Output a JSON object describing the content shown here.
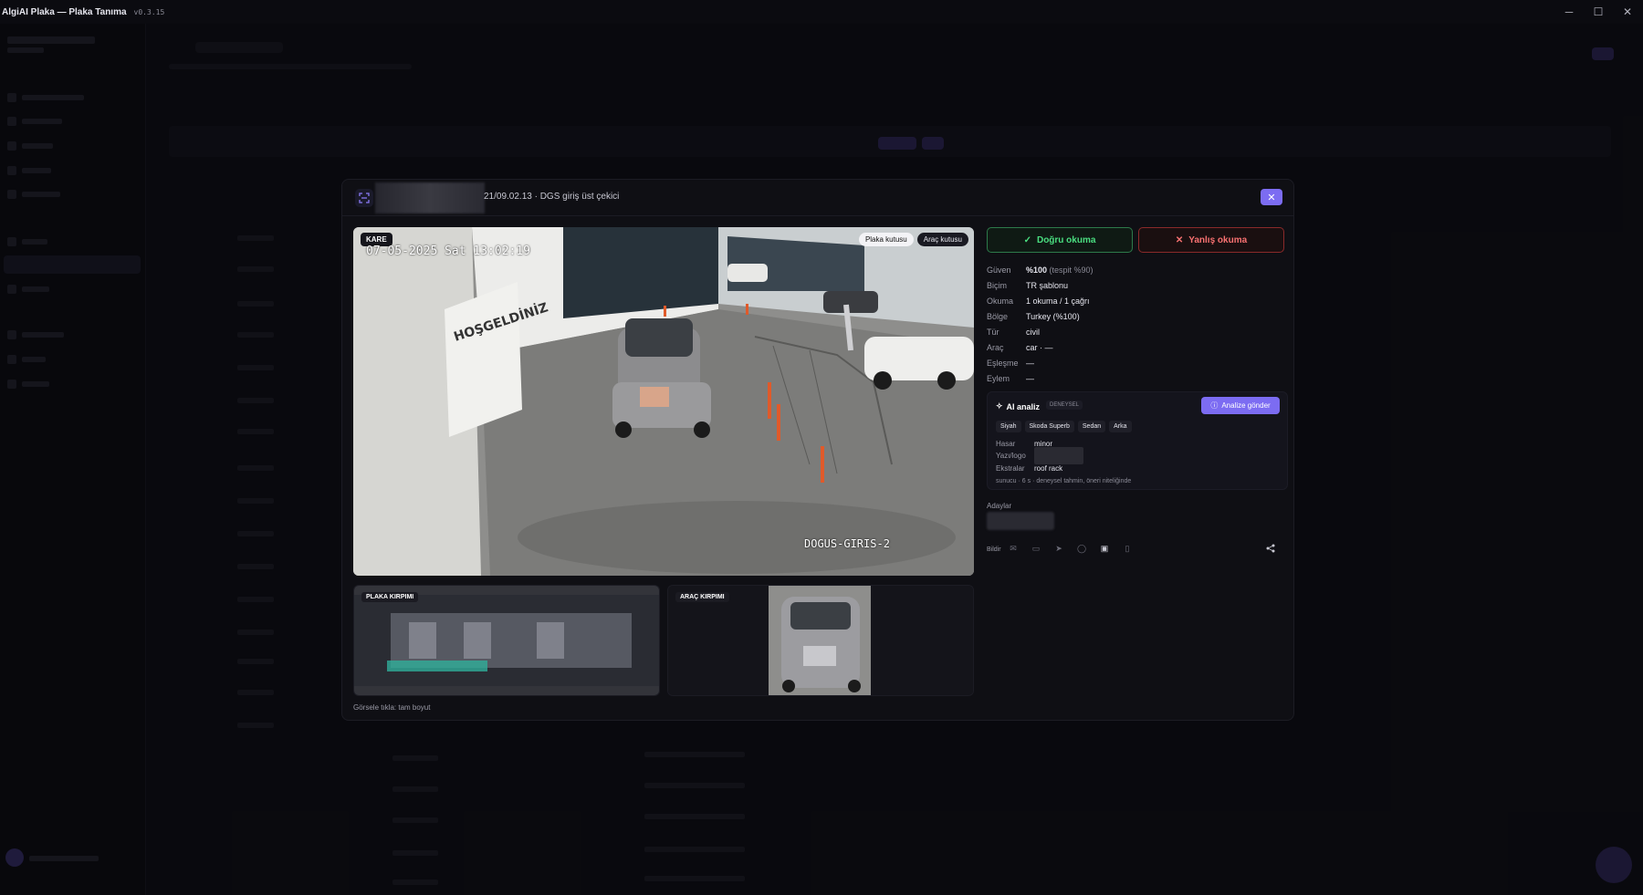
{
  "app": {
    "title": "AlgiAI Plaka — Plaka Tanıma",
    "version": "v0.3.15"
  },
  "modal": {
    "header_title": "21/09.02.13 · DGS giriş üst çekici",
    "frame": {
      "badge": "KARE",
      "osd_datetime": "07-05-2025 Sat 13:02:19",
      "osd_camera": "DOGUS-GIRIS-2",
      "toggles": [
        {
          "label": "Plaka kutusu",
          "active": true
        },
        {
          "label": "Araç kutusu",
          "active": false
        }
      ]
    },
    "crops": {
      "plate_label": "PLAKA KIRPIMI",
      "vehicle_label": "ARAÇ KIRPIMI"
    },
    "hint": "Görsele tıkla: tam boyut",
    "verdict": {
      "correct_label": "Doğru okuma",
      "wrong_label": "Yanlış okuma"
    },
    "info": [
      {
        "key": "Güven",
        "value": "%100",
        "sub": " (tespit %90)"
      },
      {
        "key": "Biçim",
        "value": "TR şablonu",
        "sub": ""
      },
      {
        "key": "Okuma",
        "value": "1 okuma / 1 çağrı",
        "sub": ""
      },
      {
        "key": "Bölge",
        "value": "Turkey (%100)",
        "sub": ""
      },
      {
        "key": "Tür",
        "value": "civil",
        "sub": ""
      },
      {
        "key": "Araç",
        "value": "car · —",
        "sub": ""
      },
      {
        "key": "Eşleşme",
        "value": "—",
        "sub": ""
      },
      {
        "key": "Eylem",
        "value": "—",
        "sub": ""
      }
    ],
    "ai": {
      "title": "AI analiz",
      "experimental": "DENEYSEL",
      "send_label": "Analize gönder",
      "tags": [
        "Siyah",
        "Skoda Superb",
        "Sedan",
        "Arka"
      ],
      "damage_key": "Hasar",
      "damage_val": "minor",
      "text_key": "Yazı/logo",
      "extras_key": "Ekstralar",
      "extras_val": "roof rack",
      "note": "sunucu · 6 s · deneysel tahmin, öneri niteliğinde"
    },
    "candidates_label": "Adaylar",
    "report_label": "Bildir"
  },
  "colors": {
    "accent": "#7c6cf2",
    "success": "#4ade80",
    "danger": "#f87171"
  }
}
